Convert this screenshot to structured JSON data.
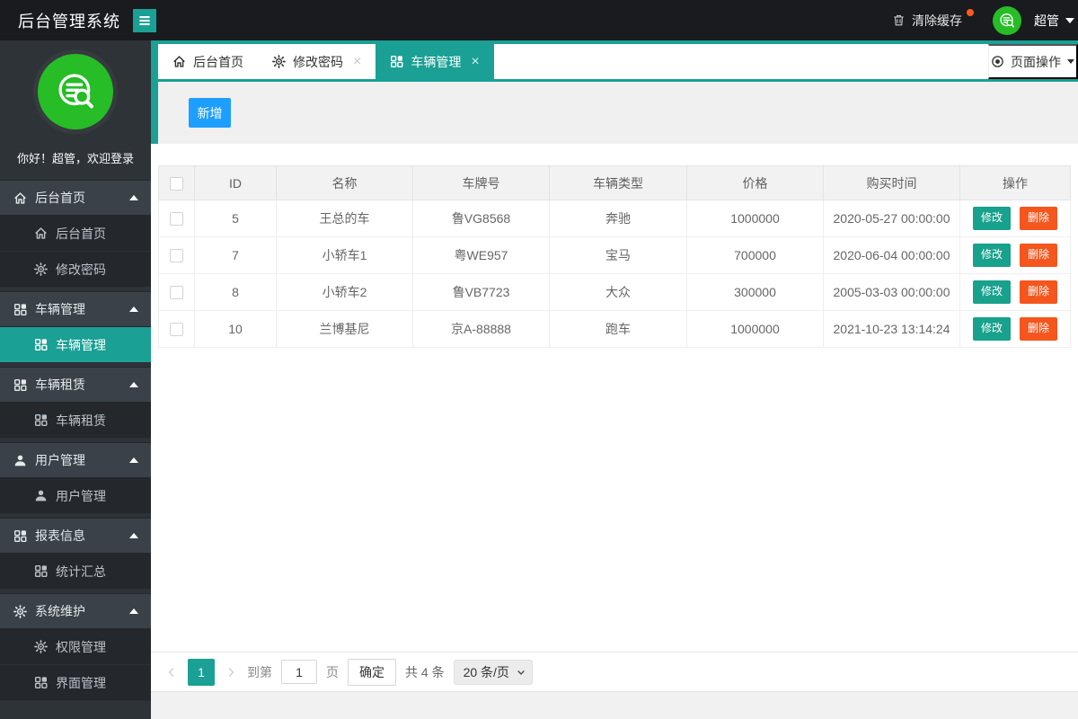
{
  "colors": {
    "theme_teal": "#1AA094",
    "button_blue": "#1E9FFF",
    "delete_orange": "#F4561E",
    "avatar_green": "#26BD26",
    "topbar_black": "#191B1F",
    "sidebar_dark": "#2E3338",
    "notification_dot": "#FF5A1E"
  },
  "topbar": {
    "title": "后台管理系统",
    "clear_cache_label": "清除缓存",
    "username": "超管"
  },
  "sidebar": {
    "greeting": "你好！超管，欢迎登录",
    "items": [
      {
        "label": "后台首页",
        "icon": "home-icon",
        "level": "parent"
      },
      {
        "label": "后台首页",
        "icon": "home-icon",
        "level": "sub"
      },
      {
        "label": "修改密码",
        "icon": "gear-icon",
        "level": "sub"
      },
      {
        "label": "车辆管理",
        "icon": "grid-icon",
        "level": "parent"
      },
      {
        "label": "车辆管理",
        "icon": "grid-icon",
        "level": "sub",
        "active": true
      },
      {
        "label": "车辆租赁",
        "icon": "grid-icon",
        "level": "parent"
      },
      {
        "label": "车辆租赁",
        "icon": "grid-icon",
        "level": "sub"
      },
      {
        "label": "用户管理",
        "icon": "user-icon",
        "level": "parent"
      },
      {
        "label": "用户管理",
        "icon": "user-icon",
        "level": "sub"
      },
      {
        "label": "报表信息",
        "icon": "grid-icon",
        "level": "parent"
      },
      {
        "label": "统计汇总",
        "icon": "grid-icon",
        "level": "sub"
      },
      {
        "label": "系统维护",
        "icon": "gear-icon",
        "level": "parent"
      },
      {
        "label": "权限管理",
        "icon": "gear-icon",
        "level": "sub"
      },
      {
        "label": "界面管理",
        "icon": "grid-icon",
        "level": "sub"
      }
    ]
  },
  "tabs": {
    "items": [
      {
        "label": "后台首页",
        "icon": "home-icon",
        "closable": false,
        "active": false
      },
      {
        "label": "修改密码",
        "icon": "gear-icon",
        "closable": true,
        "active": false,
        "close_glyph": "×"
      },
      {
        "label": "车辆管理",
        "icon": "grid-icon",
        "closable": true,
        "active": true,
        "close_glyph": "×"
      }
    ],
    "page_ops_label": "页面操作"
  },
  "toolbar": {
    "add_label": "新增"
  },
  "table": {
    "headers": [
      "ID",
      "名称",
      "车牌号",
      "车辆类型",
      "价格",
      "购买时间",
      "操作"
    ],
    "edit_label": "修改",
    "delete_label": "删除",
    "rows": [
      {
        "id": "5",
        "name": "王总的车",
        "plate": "鲁VG8568",
        "type": "奔驰",
        "price": "1000000",
        "time": "2020-05-27 00:00:00"
      },
      {
        "id": "7",
        "name": "小轿车1",
        "plate": "粤WE957",
        "type": "宝马",
        "price": "700000",
        "time": "2020-06-04 00:00:00"
      },
      {
        "id": "8",
        "name": "小轿车2",
        "plate": "鲁VB7723",
        "type": "大众",
        "price": "300000",
        "time": "2005-03-03 00:00:00"
      },
      {
        "id": "10",
        "name": "兰博基尼",
        "plate": "京A-88888",
        "type": "跑车",
        "price": "1000000",
        "time": "2021-10-23 13:14:24"
      }
    ]
  },
  "pagination": {
    "current_page": "1",
    "goto_prefix": "到第",
    "goto_value": "1",
    "goto_suffix": "页",
    "confirm_label": "确定",
    "total_label": "共 4 条",
    "page_size_option": "20 条/页"
  }
}
